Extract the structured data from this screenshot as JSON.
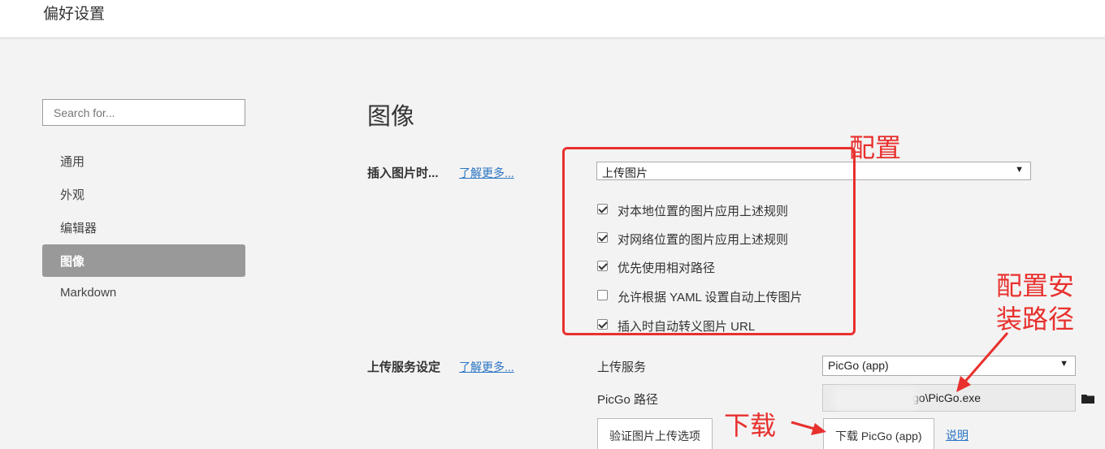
{
  "window": {
    "title": "偏好设置"
  },
  "sidebar": {
    "search_placeholder": "Search for...",
    "items": [
      {
        "label": "通用"
      },
      {
        "label": "外观"
      },
      {
        "label": "编辑器"
      },
      {
        "label": "图像",
        "active": true
      },
      {
        "label": "Markdown"
      }
    ]
  },
  "main": {
    "heading": "图像",
    "insert_section": {
      "label": "插入图片时...",
      "learn_more": "了解更多...",
      "select_value": "上传图片",
      "options": [
        {
          "label": "对本地位置的图片应用上述规则",
          "checked": true
        },
        {
          "label": "对网络位置的图片应用上述规则",
          "checked": true
        },
        {
          "label": "优先使用相对路径",
          "checked": true
        },
        {
          "label": "允许根据 YAML 设置自动上传图片",
          "checked": false
        },
        {
          "label": "插入时自动转义图片 URL",
          "checked": true
        }
      ]
    },
    "upload_section": {
      "label": "上传服务设定",
      "learn_more": "了解更多...",
      "service_label": "上传服务",
      "service_value": "PicGo (app)",
      "path_label": "PicGo 路径",
      "path_value": "go\\PicGo.exe",
      "verify_button": "验证图片上传选项",
      "download_button": "下载 PicGo (app)",
      "help_link": "说明"
    }
  },
  "annotations": {
    "config": "配置",
    "config_path_line1": "配置安",
    "config_path_line2": "装路径",
    "download": "下载",
    "color": "#e8302d"
  },
  "icons": {
    "dropdown": "triangle-down-icon",
    "folder": "folder-icon"
  }
}
